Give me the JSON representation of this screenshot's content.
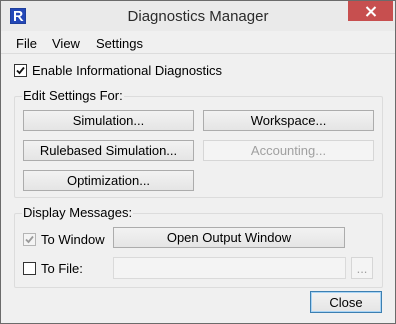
{
  "window": {
    "title": "Diagnostics Manager",
    "title_bar_color": "#eaeaea",
    "close_button_color": "#c74f4f"
  },
  "menu": {
    "items": [
      "File",
      "View",
      "Settings"
    ]
  },
  "enable_diagnostics": {
    "label": "Enable Informational Diagnostics",
    "checked": true
  },
  "edit_settings": {
    "title": "Edit Settings For:",
    "buttons": {
      "simulation": "Simulation...",
      "workspace": "Workspace...",
      "rulebased_simulation": "Rulebased Simulation...",
      "accounting": "Accounting...",
      "optimization": "Optimization..."
    }
  },
  "display_messages": {
    "title": "Display Messages:",
    "to_window_label": "To Window",
    "to_window_checked": true,
    "open_output_window": "Open Output Window",
    "to_file_label": "To File:",
    "to_file_checked": false,
    "file_path_value": "",
    "browse_label": "..."
  },
  "footer": {
    "close_label": "Close"
  }
}
